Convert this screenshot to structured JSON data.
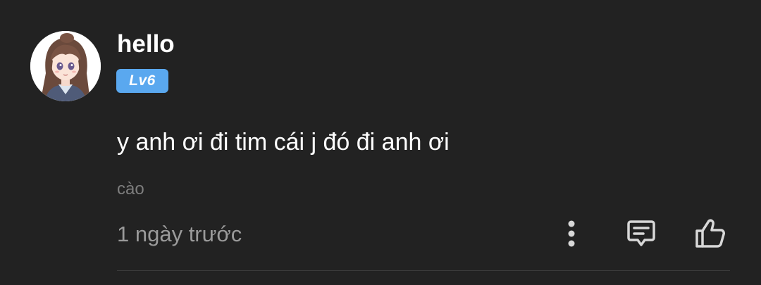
{
  "comment": {
    "username": "hello",
    "level": "Lv6",
    "content": "y anh ơi đi tim cái j đó đi anh ơi",
    "tag": "cào",
    "timestamp": "1 ngày trước"
  },
  "icons": {
    "more": "more-vertical-icon",
    "reply": "comment-reply-icon",
    "like": "thumbs-up-icon"
  },
  "colors": {
    "background": "#222222",
    "level_badge": "#5aa8ef",
    "primary_text": "#ffffff",
    "secondary_text": "#9a9a9a",
    "icon": "#d8d8d8"
  }
}
